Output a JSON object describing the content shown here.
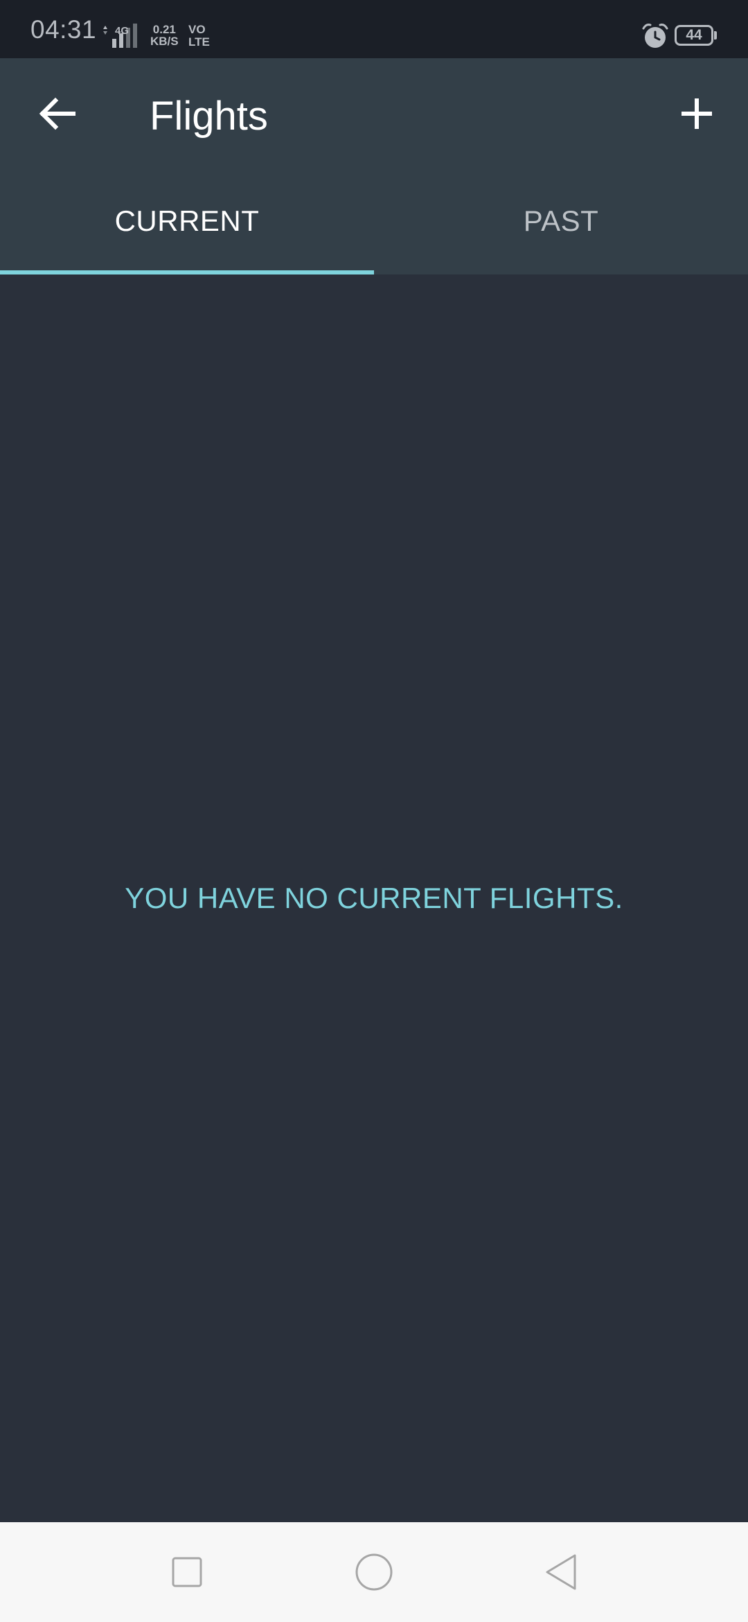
{
  "status_bar": {
    "time": "04:31",
    "network_type": "4G",
    "data_speed_value": "0.21",
    "data_speed_unit": "KB/S",
    "volte_line1": "VO",
    "volte_line2": "LTE",
    "battery": "44",
    "icons": [
      "signal-icon",
      "alarm-icon",
      "battery-icon"
    ]
  },
  "app_bar": {
    "title": "Flights",
    "back_icon": "arrow-left-icon",
    "add_icon": "plus-icon"
  },
  "tabs": [
    {
      "label": "CURRENT",
      "selected": true
    },
    {
      "label": "PAST",
      "selected": false
    }
  ],
  "content": {
    "empty_message": "YOU HAVE NO CURRENT FLIGHTS."
  },
  "nav_bar": {
    "icons": [
      "recents-square-icon",
      "home-circle-icon",
      "back-triangle-icon"
    ]
  },
  "colors": {
    "status_bar_bg": "#1b1f27",
    "app_bar_bg": "#333f48",
    "content_bg": "#2a303b",
    "accent": "#7fd3dd",
    "nav_bar_bg": "#f7f7f7"
  }
}
